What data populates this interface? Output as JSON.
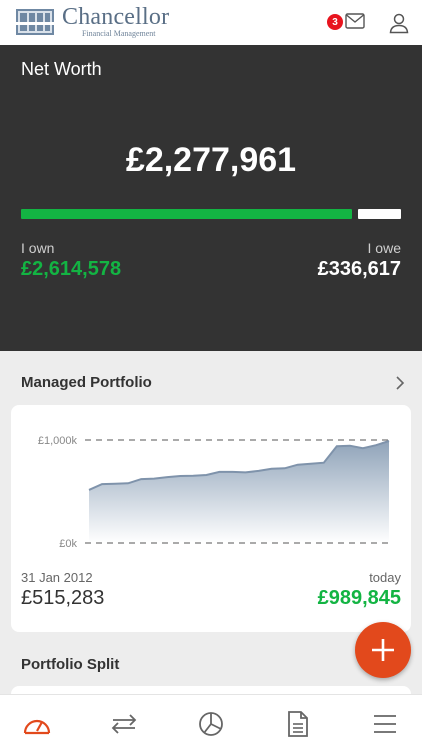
{
  "header": {
    "logo": {
      "name": "Chancellor",
      "subtitle": "Financial Management"
    },
    "notifications": {
      "count": "3"
    },
    "icons": [
      "logo-mark",
      "mail-icon",
      "user-icon"
    ]
  },
  "net_worth": {
    "label": "Net Worth",
    "total": "£2,277,961",
    "own": {
      "label": "I own",
      "value": "£2,614,578",
      "amount": 2614578
    },
    "owe": {
      "label": "I owe",
      "value": "£336,617",
      "amount": 336617
    },
    "colors": {
      "own": "#13b443",
      "owe": "#ffffff",
      "background": "#333333"
    }
  },
  "managed_portfolio": {
    "title": "Managed Portfolio",
    "start": {
      "date": "31 Jan 2012",
      "value": "£515,283"
    },
    "end": {
      "date": "today",
      "value": "£989,845"
    }
  },
  "chart_data": {
    "type": "area",
    "y_tick_labels": [
      "£1,000k",
      "£0k"
    ],
    "ylim": [
      0,
      1000000
    ],
    "grid": "dashed lines at tick values",
    "values": [
      515283,
      572000,
      575000,
      580000,
      620000,
      625000,
      640000,
      650000,
      652000,
      660000,
      690000,
      690000,
      685000,
      700000,
      720000,
      725000,
      760000,
      770000,
      780000,
      940000,
      945000,
      920000,
      950000,
      989845
    ],
    "color": "#7f93ab"
  },
  "portfolio_split": {
    "title": "Portfolio Split"
  },
  "fab": {
    "icon": "plus-icon",
    "color": "#e2491c"
  },
  "nav": {
    "items": [
      {
        "icon": "dashboard-gauge-icon",
        "active": true
      },
      {
        "icon": "transfer-arrows-icon",
        "active": false
      },
      {
        "icon": "pie-chart-icon",
        "active": false
      },
      {
        "icon": "document-icon",
        "active": false
      },
      {
        "icon": "menu-icon",
        "active": false
      }
    ],
    "active_color": "#e2491c"
  }
}
